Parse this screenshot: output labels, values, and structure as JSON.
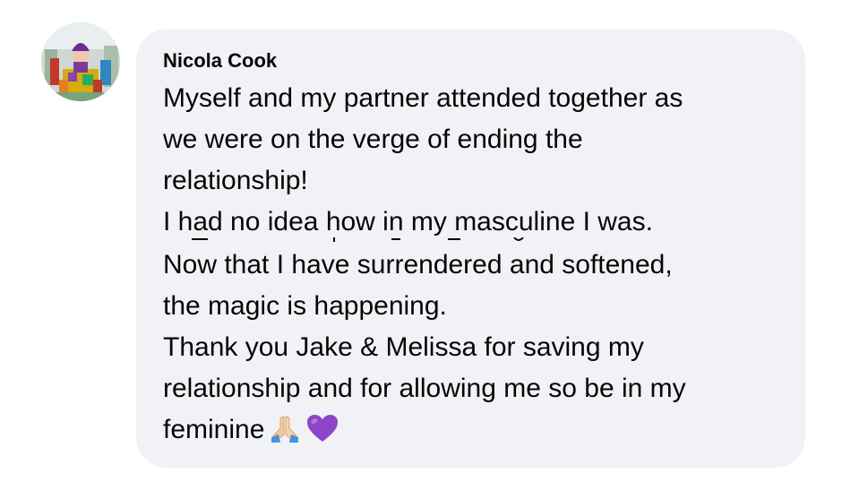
{
  "comment": {
    "author": "Nicola Cook",
    "lines": [
      "Myself and my partner attended together as",
      "we were on the verge of ending the",
      "relationship!",
      "I had no idea how in my masculine I was.",
      "Now that I have surrendered and softened,",
      "the magic is happening.",
      "Thank you Jake & Melissa for saving my",
      "relationship and for allowing me so be in my",
      "feminine"
    ],
    "emojis": [
      "folded-hands-icon",
      "purple-heart-icon"
    ]
  },
  "colors": {
    "bubble_background": "#f0f2f5",
    "text": "#050505",
    "heart": "#8e44c9",
    "hands": "#f3c9a0"
  }
}
